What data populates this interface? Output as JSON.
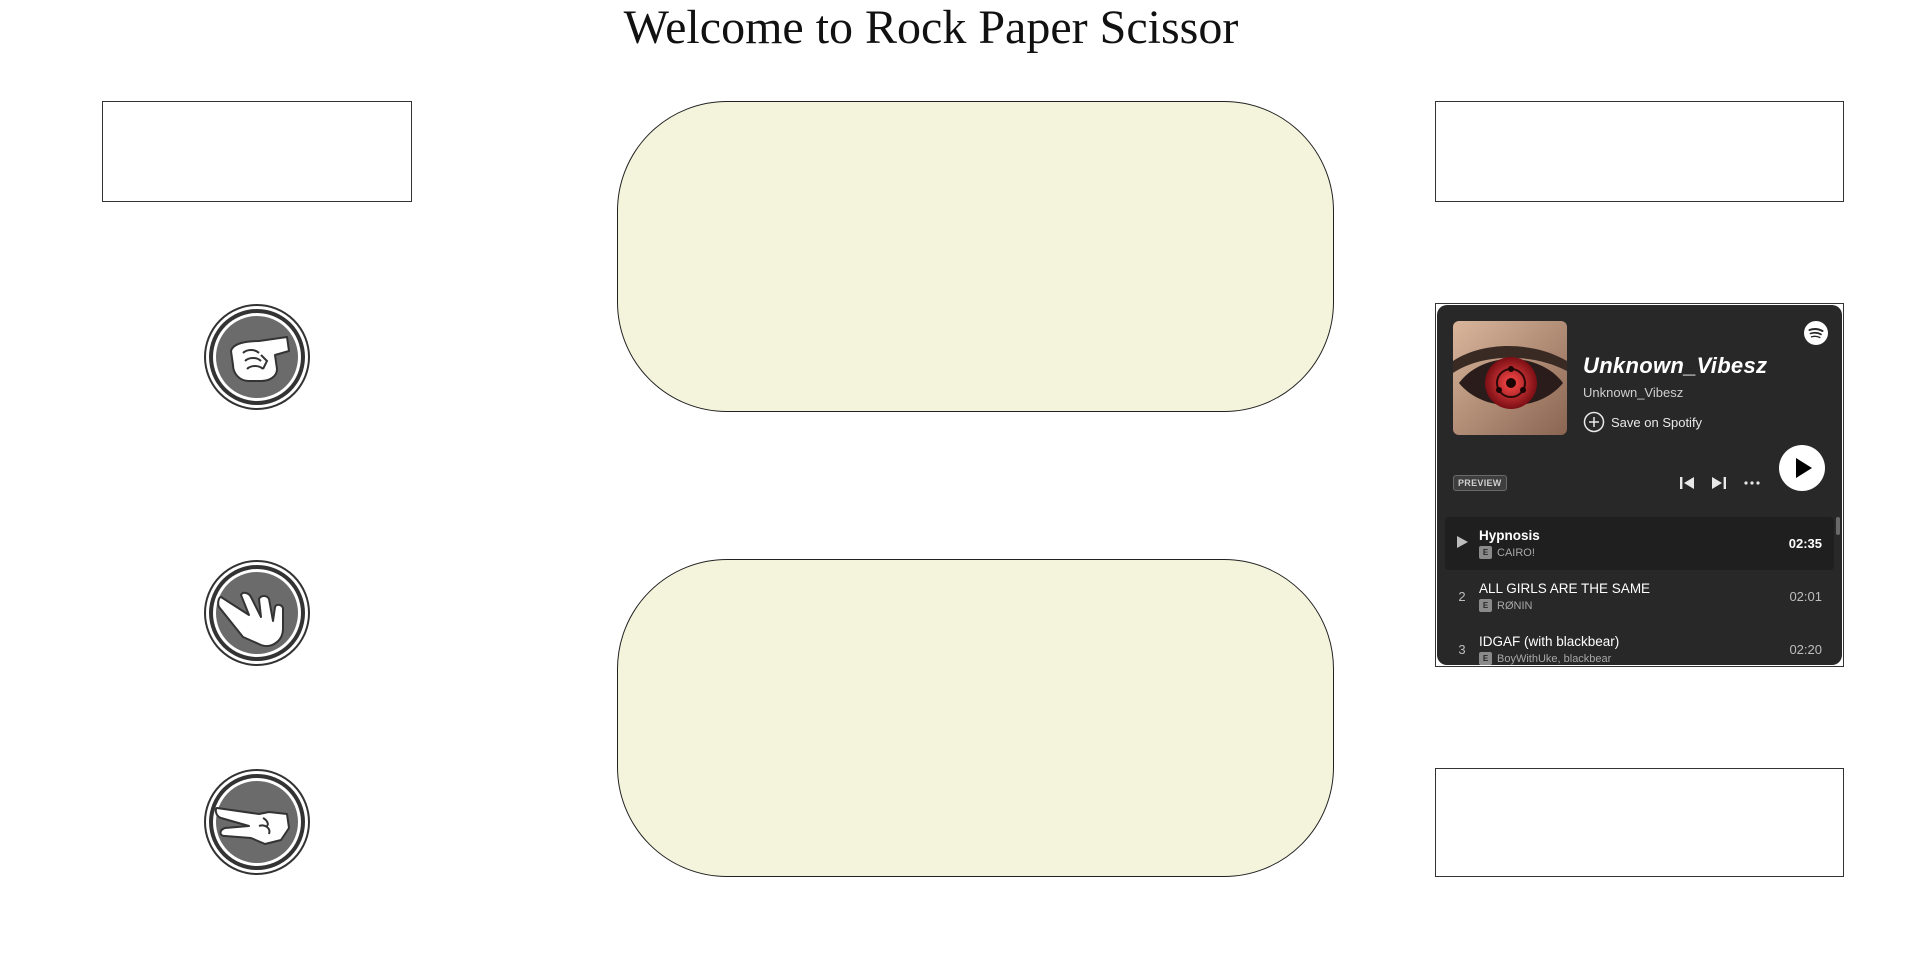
{
  "page": {
    "title": "Welcome to Rock Paper Scissor"
  },
  "choices": [
    {
      "name": "rock",
      "icon": "rock-fist-icon"
    },
    {
      "name": "paper",
      "icon": "paper-hand-icon"
    },
    {
      "name": "scissor",
      "icon": "scissor-hand-icon"
    }
  ],
  "colors": {
    "pill_bg": "#f4f4dc",
    "spotify_bg": "#282828",
    "icon_gray": "#6b6b6b"
  },
  "spotify": {
    "playlist_title": "Unknown_Vibesz",
    "owner": "Unknown_Vibesz",
    "save_label": "Save on Spotify",
    "preview_badge": "PREVIEW",
    "tracks": [
      {
        "num": "",
        "title": "Hypnosis",
        "artist": "CAIRO!",
        "explicit": "E",
        "duration": "02:35"
      },
      {
        "num": "2",
        "title": "ALL GIRLS ARE THE SAME",
        "artist": "RØNIN",
        "explicit": "E",
        "duration": "02:01"
      },
      {
        "num": "3",
        "title": "IDGAF (with blackbear)",
        "artist": "BoyWithUke, blackbear",
        "explicit": "E",
        "duration": "02:20"
      }
    ]
  }
}
